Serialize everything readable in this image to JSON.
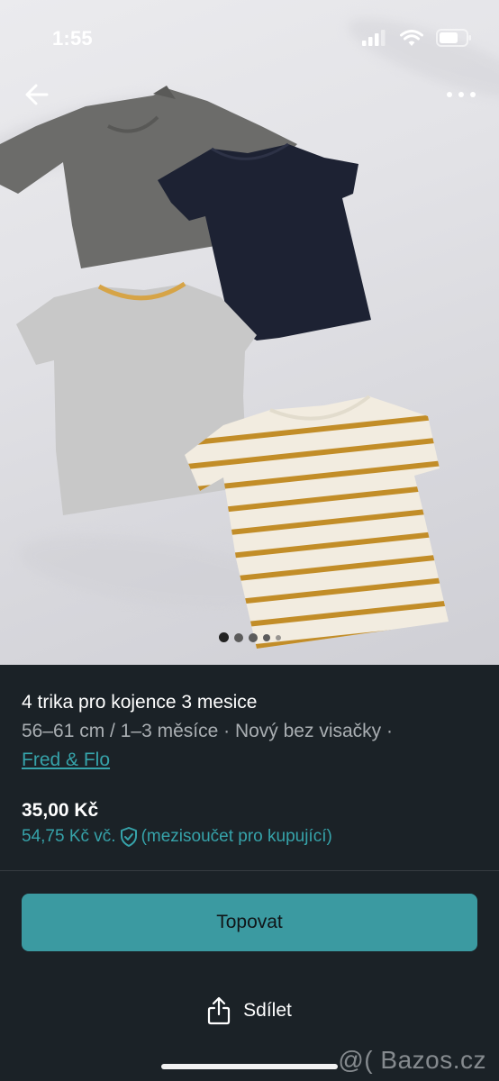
{
  "status_bar": {
    "time": "1:55"
  },
  "gallery": {
    "image_count": 5,
    "active_index": 0
  },
  "listing": {
    "title": "4 trika pro kojence 3  mesice",
    "meta": "56–61 cm / 1–3 měsíce · Nový bez visačky ·",
    "brand": "Fred & Flo",
    "price": "35,00 Kč",
    "total_price": "54,75 Kč vč.",
    "total_note": "(mezisoučet pro kupující)"
  },
  "actions": {
    "promote_label": "Topovat",
    "share_label": "Sdílet"
  },
  "watermark": "@( Bazos.cz",
  "colors": {
    "background": "#1b2227",
    "accent": "#36a3aa",
    "button": "#3b9aa1"
  },
  "icons": [
    "back-arrow-icon",
    "more-options-icon",
    "shield-check-icon",
    "share-icon",
    "signal-icon",
    "wifi-icon",
    "battery-icon"
  ]
}
